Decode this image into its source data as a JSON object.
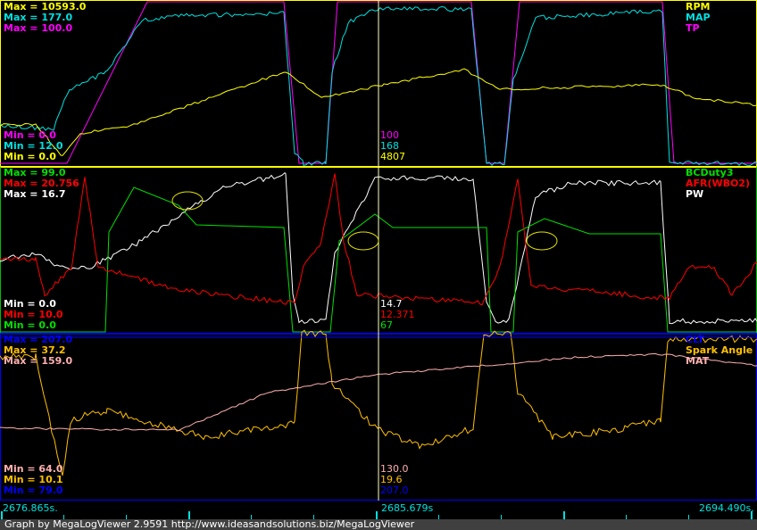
{
  "panels": [
    {
      "max": [
        {
          "text": "Max = 10593.0",
          "color": "#ffff00"
        },
        {
          "text": "Max = 177.0",
          "color": "#00e0e0"
        },
        {
          "text": "Max = 100.0",
          "color": "#ff00ff"
        }
      ],
      "min": [
        {
          "text": "Min = 0.0",
          "color": "#ff00ff"
        },
        {
          "text": "Min = 12.0",
          "color": "#00e0e0"
        },
        {
          "text": "Min = 0.0",
          "color": "#ffff00"
        }
      ],
      "legend": [
        {
          "text": "RPM",
          "color": "#ffff00"
        },
        {
          "text": "MAP",
          "color": "#00e0e0"
        },
        {
          "text": "TP",
          "color": "#ff00ff"
        }
      ],
      "cursor": [
        {
          "text": "100",
          "color": "#ff00ff"
        },
        {
          "text": "168",
          "color": "#00e0e0"
        },
        {
          "text": "4807",
          "color": "#ffff00"
        }
      ]
    },
    {
      "max": [
        {
          "text": "Max = 99.0",
          "color": "#00e000"
        },
        {
          "text": "Max = 20.756",
          "color": "#ff0000"
        },
        {
          "text": "Max = 16.7",
          "color": "#ffffff"
        }
      ],
      "min": [
        {
          "text": "Min = 0.0",
          "color": "#ffffff"
        },
        {
          "text": "Min = 10.0",
          "color": "#ff0000"
        },
        {
          "text": "Min = 0.0",
          "color": "#00e000"
        }
      ],
      "legend": [
        {
          "text": "BCDuty3",
          "color": "#00e000"
        },
        {
          "text": "AFR(WBO2)",
          "color": "#ff0000"
        },
        {
          "text": "PW",
          "color": "#ffffff"
        }
      ],
      "cursor": [
        {
          "text": "14.7",
          "color": "#ffffff"
        },
        {
          "text": "12.371",
          "color": "#ff0000"
        },
        {
          "text": "67",
          "color": "#00e000"
        }
      ]
    },
    {
      "max": [
        {
          "text": "Max = 207.0",
          "color": "#0000ff"
        },
        {
          "text": "Max = 37.2",
          "color": "#ffc000"
        },
        {
          "text": "Max = 159.0",
          "color": "#ffb0b0"
        }
      ],
      "min": [
        {
          "text": "Min = 64.0",
          "color": "#ffb0b0"
        },
        {
          "text": "Min = 10.1",
          "color": "#ffc000"
        },
        {
          "text": "Min = 79.0",
          "color": "#0000ff"
        }
      ],
      "legend": [
        {
          "text": "CLT",
          "color": "#0000ff"
        },
        {
          "text": "Spark Angle",
          "color": "#ffc000"
        },
        {
          "text": "MAT",
          "color": "#ffb0b0"
        }
      ],
      "cursor": [
        {
          "text": "130.0",
          "color": "#ffb0b0"
        },
        {
          "text": "19.6",
          "color": "#ffc000"
        },
        {
          "text": "207.0",
          "color": "#0000ff"
        }
      ]
    }
  ],
  "time_axis": {
    "start": "2676.865s.",
    "cursor": "2685.679s",
    "end": "2694.490s."
  },
  "footer": "Graph by MegaLogViewer 2.9591 http://www.ideasandsolutions.biz/MegaLogViewer"
}
